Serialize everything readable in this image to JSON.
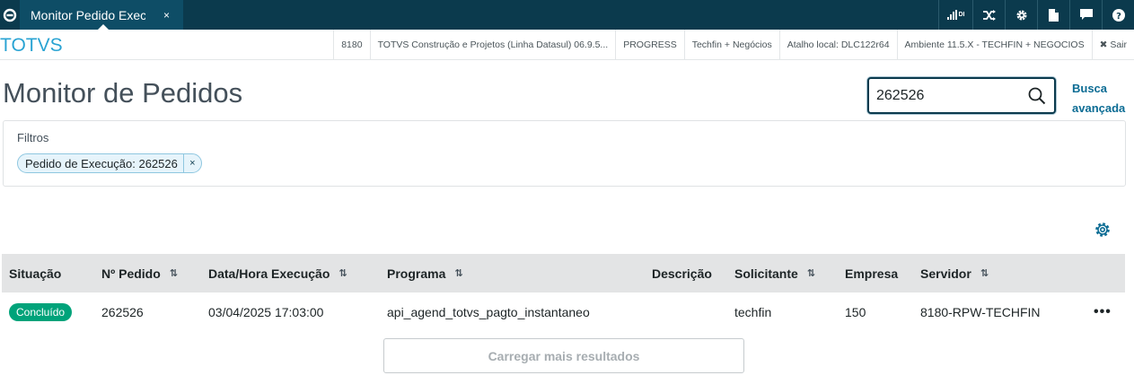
{
  "tab": {
    "label": "Monitor Pedido Execução",
    "close": "×"
  },
  "top_icons": {
    "di": "DI",
    "items": [
      "signal-icon",
      "shuffle-icon",
      "gear-icon",
      "document-icon",
      "chat-icon",
      "help-icon"
    ]
  },
  "infobar": {
    "brand": "TOTVS",
    "items": [
      "8180",
      "TOTVS Construção e Projetos (Linha Datasul) 06.9.5...",
      "PROGRESS",
      "Techfin + Negócios",
      "Atalho local: DLC122r64",
      "Ambiente 11.5.X - TECHFIN + NEGOCIOS"
    ],
    "exit": "✖ Sair"
  },
  "page": {
    "title": "Monitor de Pedidos",
    "search_value": "262526",
    "advanced_search": "Busca avançada"
  },
  "filters": {
    "title": "Filtros",
    "tag": "Pedido de Execução: 262526",
    "tag_close": "×"
  },
  "table": {
    "columns": [
      "Situação",
      "Nº Pedido",
      "Data/Hora Execução",
      "Programa",
      "Descrição",
      "Solicitante",
      "Empresa",
      "Servidor"
    ],
    "sortable": [
      false,
      true,
      true,
      true,
      false,
      true,
      false,
      true
    ],
    "sort_icon": "⇅",
    "rows": [
      {
        "status": "Concluído",
        "order": "262526",
        "datetime": "03/04/2025 17:03:00",
        "program": "api_agend_totvs_pagto_instantaneo",
        "description": "",
        "requester": "techfin",
        "company": "150",
        "server": "8180-RPW-TECHFIN",
        "more": "•••"
      }
    ]
  },
  "load_more": "Carregar mais resultados",
  "colors": {
    "topbar": "#0b3a4d",
    "tab_active": "#0e4d66",
    "brand": "#29a3d3",
    "status_success": "#00a37a",
    "link": "#0c6c94"
  }
}
